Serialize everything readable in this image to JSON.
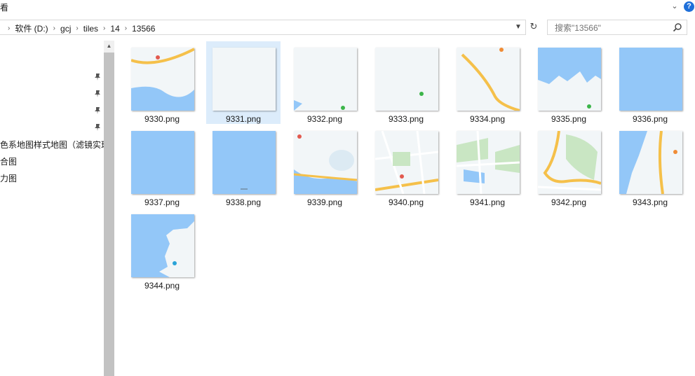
{
  "ribbon": {
    "view_tab": "看",
    "help": "?"
  },
  "address": {
    "segments": [
      "软件 (D:)",
      "gcj",
      "tiles",
      "14",
      "13566"
    ]
  },
  "search": {
    "placeholder": "搜索\"13566\""
  },
  "nav": {
    "items": [
      "色系地图样式地图（滤镜实现",
      "合图",
      "力图"
    ]
  },
  "files": [
    {
      "name": "9330.png",
      "style": "road-coast"
    },
    {
      "name": "9331.png",
      "style": "plain",
      "selected": true
    },
    {
      "name": "9332.png",
      "style": "plain-water-corner"
    },
    {
      "name": "9333.png",
      "style": "plain-poi"
    },
    {
      "name": "9334.png",
      "style": "road-diagonal"
    },
    {
      "name": "9335.png",
      "style": "water-top"
    },
    {
      "name": "9336.png",
      "style": "water"
    },
    {
      "name": "9337.png",
      "style": "water"
    },
    {
      "name": "9338.png",
      "style": "water-label"
    },
    {
      "name": "9339.png",
      "style": "city-lake"
    },
    {
      "name": "9340.png",
      "style": "city-streets"
    },
    {
      "name": "9341.png",
      "style": "city-green"
    },
    {
      "name": "9342.png",
      "style": "city-park"
    },
    {
      "name": "9343.png",
      "style": "coast-right"
    },
    {
      "name": "9344.png",
      "style": "coast-bottom"
    }
  ],
  "colors": {
    "water": "#93c7f8",
    "land": "#f2f6f8",
    "road": "#f5c04a",
    "green": "#c9e6c3",
    "selection": "#dcecfb"
  }
}
